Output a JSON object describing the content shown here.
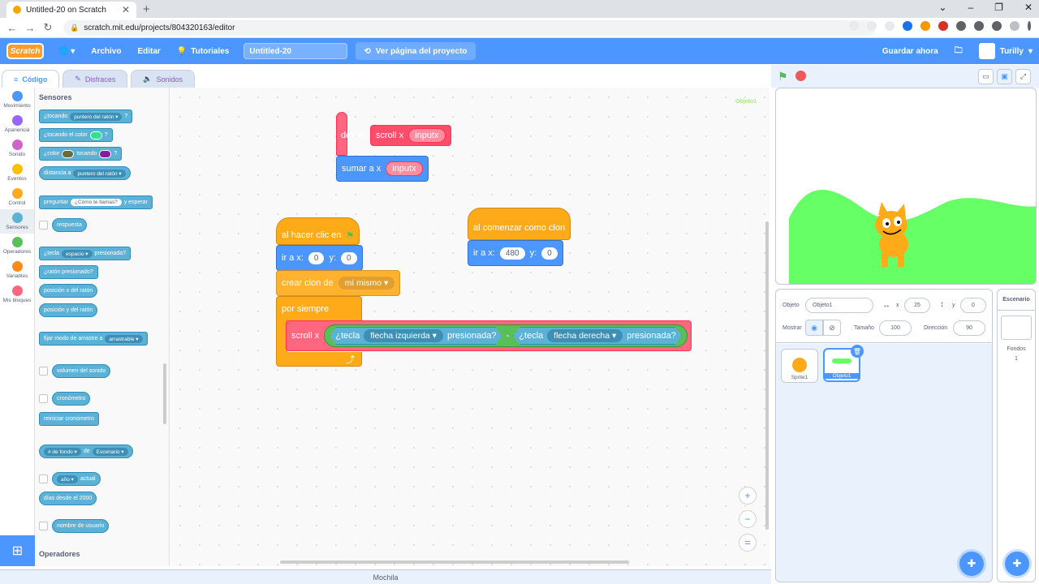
{
  "browser": {
    "tab_title": "Untitled-20 on Scratch",
    "new_tab": "+",
    "url": "scratch.mit.edu/projects/804320163/editor"
  },
  "menubar": {
    "logo": "Scratch",
    "file": "Archivo",
    "edit": "Editar",
    "tutorials": "Tutoriales",
    "project_title": "Untitled-20",
    "see_project": "Ver página del proyecto",
    "save_now": "Guardar ahora",
    "username": "Turilly"
  },
  "editor_tabs": [
    "Código",
    "Disfraces",
    "Sonidos"
  ],
  "categories": [
    {
      "label": "Movimiento",
      "color": "#4c97ff"
    },
    {
      "label": "Apariencia",
      "color": "#9966ff"
    },
    {
      "label": "Sonido",
      "color": "#cf63cf"
    },
    {
      "label": "Eventos",
      "color": "#ffbf00"
    },
    {
      "label": "Control",
      "color": "#ffab19"
    },
    {
      "label": "Sensores",
      "color": "#5cb1d6"
    },
    {
      "label": "Operadores",
      "color": "#59c059"
    },
    {
      "label": "Variables",
      "color": "#ff8c1a"
    },
    {
      "label": "Mis bloques",
      "color": "#ff6680"
    }
  ],
  "palette": {
    "heading": "Sensores",
    "footer_heading": "Operadores",
    "touching": "¿tocando",
    "touching_menu": "puntero del ratón",
    "q": "?",
    "touching_color": "¿tocando el color",
    "color_is": "¿color",
    "color_touching": "tocando",
    "distance": "distancia a",
    "distance_menu": "puntero del ratón",
    "ask": "preguntar",
    "ask_default": "¿Cómo te llamas?",
    "ask_wait": "y esperar",
    "answer": "respuesta",
    "key": "¿tecla",
    "key_menu": "espacio",
    "key_pressed": "presionada?",
    "mouse_down": "¿ratón presionado?",
    "mouse_x": "posición x del ratón",
    "mouse_y": "posición y del ratón",
    "drag_mode": "fijar modo de arrastre a",
    "drag_menu": "arrastrable",
    "loudness": "volumen del sonido",
    "timer": "cronómetro",
    "reset_timer": "reiniciar cronómetro",
    "backdrop_num": "# de fondo",
    "of": "de",
    "of_menu": "Escenario",
    "year": "año",
    "current": "actual",
    "days_since": "días desde el 2000",
    "username": "nombre de usuario",
    "colors": {
      "touch_color": "#33e08f",
      "color_a": "#6b6a3a",
      "color_b": "#8a1a9e"
    }
  },
  "scripts": {
    "define_label": "definir",
    "define_name": "scroll x",
    "define_arg": "inputx",
    "change_x": "sumar a x",
    "change_x_arg": "inputx",
    "flag_hat": "al hacer clic en",
    "goto_label": "ir a x:",
    "goto_x": "0",
    "y_label": "y:",
    "goto_y": "0",
    "create_clone": "crear clon de",
    "clone_menu": "mí mismo",
    "forever": "por siempre",
    "call_scroll": "scroll x",
    "key1": "¿tecla",
    "key1_menu": "flecha izquierda",
    "pressed1": "presionada?",
    "minus": "-",
    "key2": "¿tecla",
    "key2_menu": "flecha derecha",
    "pressed2": "presionada?",
    "clone_hat": "al comenzar como clon",
    "clone_goto": "ir a x:",
    "clone_x": "480",
    "clone_y_label": "y:",
    "clone_y": "0"
  },
  "code_ghost": "Objeto1",
  "zoom": {
    "in": "+",
    "out": "−",
    "reset": "="
  },
  "sprite_info": {
    "object_label": "Objeto",
    "object_name": "Objeto1",
    "x_label": "x",
    "x": "25",
    "y_label": "y",
    "y": "0",
    "show_label": "Mostrar",
    "size_label": "Tamaño",
    "size": "100",
    "direction_label": "Dirección",
    "direction": "90"
  },
  "sprites": [
    {
      "name": "Sprite1",
      "selected": false
    },
    {
      "name": "Objeto1",
      "selected": true
    }
  ],
  "stage_panel": {
    "title": "Escenario",
    "backdrops_label": "Fondos",
    "backdrops_count": "1"
  },
  "backpack": "Mochila"
}
